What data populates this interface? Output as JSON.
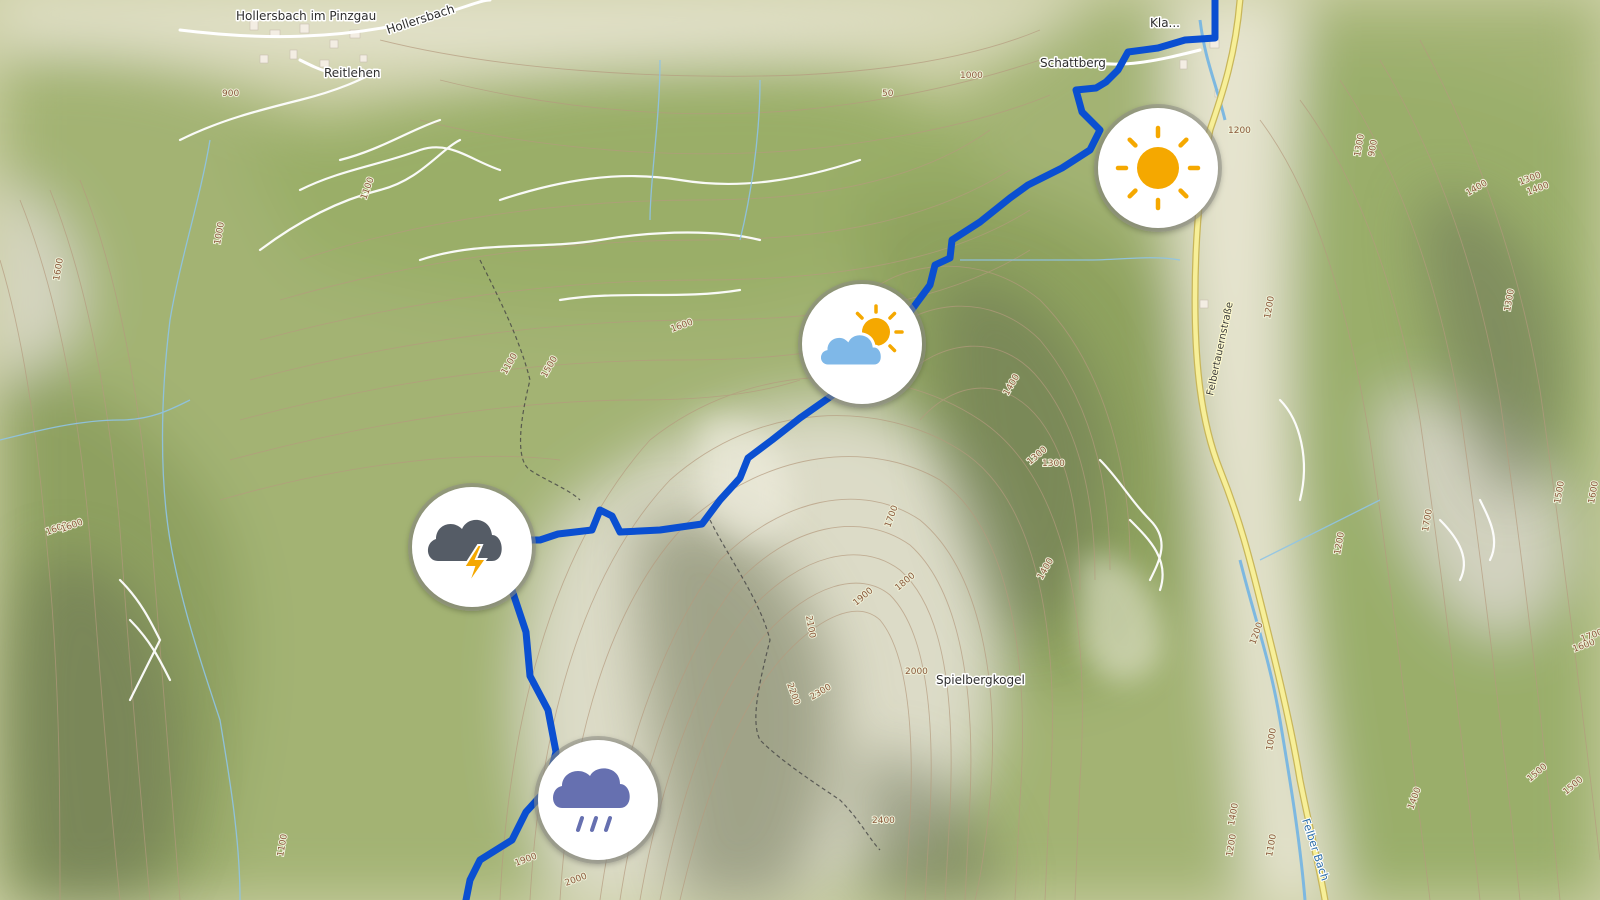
{
  "map": {
    "colors": {
      "route": "#0a4fd1",
      "meadow": "#b5c48c",
      "forest": "#8fa364",
      "rock": "#d8d6c6",
      "valley": "#e7e6d2",
      "contour": "#b59a7e",
      "road": "#f5ec8e",
      "water": "#8fc4e6"
    },
    "places": [
      {
        "id": "hollersbach-im-pinzgau",
        "label": "Hollersbach im Pinzgau"
      },
      {
        "id": "hollersbach-street",
        "label": "Hollersbach"
      },
      {
        "id": "reitlehen",
        "label": "Reitlehen"
      },
      {
        "id": "klausen",
        "label": "Kla..."
      },
      {
        "id": "schattberg",
        "label": "Schattberg"
      },
      {
        "id": "spielbergkogel",
        "label": "Spielbergkogel"
      }
    ],
    "roads": [
      {
        "id": "felbertauernstrasse",
        "label": "Felbertauernstraße"
      }
    ],
    "waters": [
      {
        "id": "felber-bach",
        "label": "Felber Bach"
      }
    ],
    "elevations": [
      "900",
      "1000",
      "50",
      "1200",
      "1400",
      "1100",
      "1300",
      "1300",
      "1000",
      "1600",
      "1500",
      "1400",
      "1300",
      "1200",
      "1100",
      "1600",
      "1400",
      "1300",
      "1200",
      "1600",
      "1500",
      "1700",
      "1800",
      "1900",
      "2000",
      "2100",
      "2200",
      "2300",
      "2400",
      "1900",
      "2000",
      "1300",
      "1100",
      "1500",
      "1600",
      "1400",
      "1600",
      "1700",
      "1500",
      "1400",
      "1200",
      "1100",
      "1000",
      "1200",
      "1400",
      "900",
      "1600",
      "1700"
    ],
    "weather_markers": [
      {
        "id": "sunny",
        "icon": "sun-icon",
        "color": "#f5a800"
      },
      {
        "id": "partly-cloudy",
        "icon": "partly-cloudy-icon",
        "color": "#7fb8e8"
      },
      {
        "id": "thunderstorm",
        "icon": "thunderstorm-icon",
        "color": "#555c66"
      },
      {
        "id": "rain",
        "icon": "rain-icon",
        "color": "#6670b0"
      }
    ]
  }
}
